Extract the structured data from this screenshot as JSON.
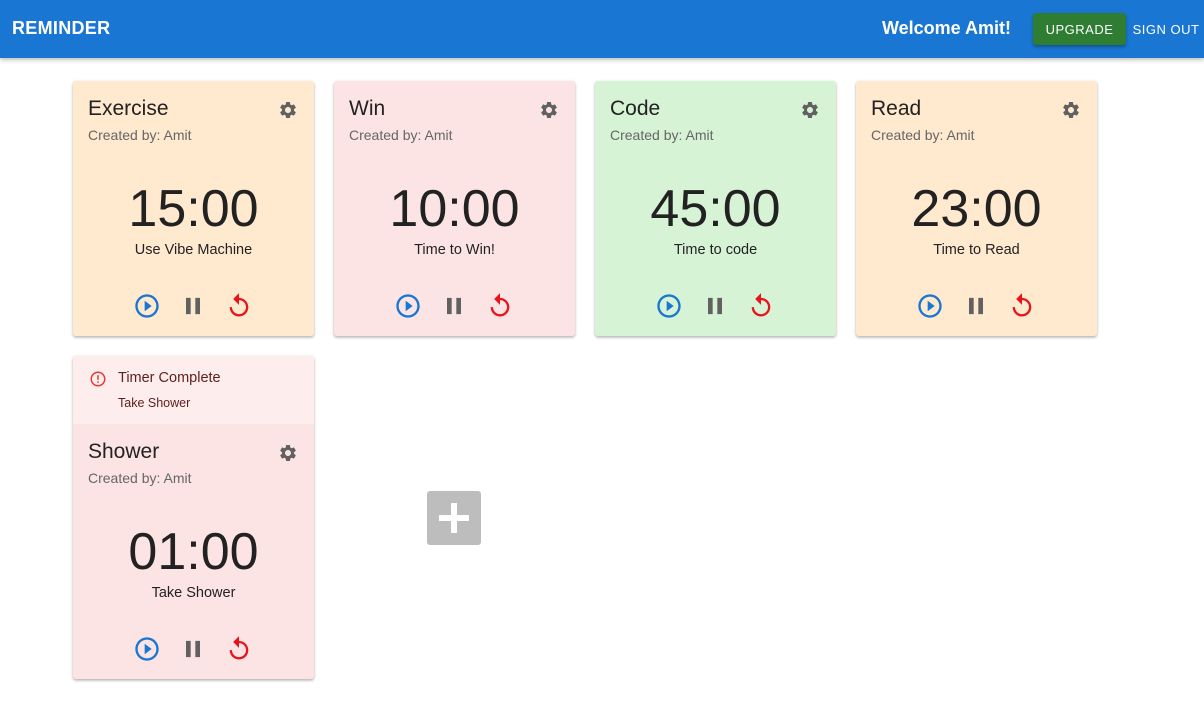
{
  "appbar": {
    "title": "REMINDER",
    "welcome": "Welcome Amit!",
    "upgrade_label": "UPGRADE",
    "signout_label": "SIGN OUT",
    "color": "#1976d2",
    "upgrade_color": "#2e7d32"
  },
  "timers": [
    {
      "title": "Exercise",
      "created_by": "Created by: Amit",
      "time": "15:00",
      "message": "Use Vibe Machine",
      "bg_color": "#ffe9cf"
    },
    {
      "title": "Win",
      "created_by": "Created by: Amit",
      "time": "10:00",
      "message": "Time to Win!",
      "bg_color": "#fde4e4"
    },
    {
      "title": "Code",
      "created_by": "Created by: Amit",
      "time": "45:00",
      "message": "Time to code",
      "bg_color": "#d7f3d6"
    },
    {
      "title": "Read",
      "created_by": "Created by: Amit",
      "time": "23:00",
      "message": "Time to Read",
      "bg_color": "#ffe9cf"
    },
    {
      "title": "Shower",
      "created_by": "Created by: Amit",
      "time": "01:00",
      "message": "Take Shower",
      "bg_color": "#fde4e4",
      "alert": {
        "title": "Timer Complete",
        "message": "Take Shower"
      }
    }
  ],
  "icons": {
    "settings": "gear-icon",
    "play": "play-circle-icon",
    "pause": "pause-icon",
    "reset": "restart-icon",
    "add": "plus-icon",
    "alert": "error-outline-icon"
  },
  "colors": {
    "play": "#1976d2",
    "pause": "#616161",
    "reset": "#e8141c",
    "gear": "#616161",
    "add_button": "#bdbdbd",
    "alert_bg": "#fdeded",
    "alert_icon": "#e53935"
  }
}
